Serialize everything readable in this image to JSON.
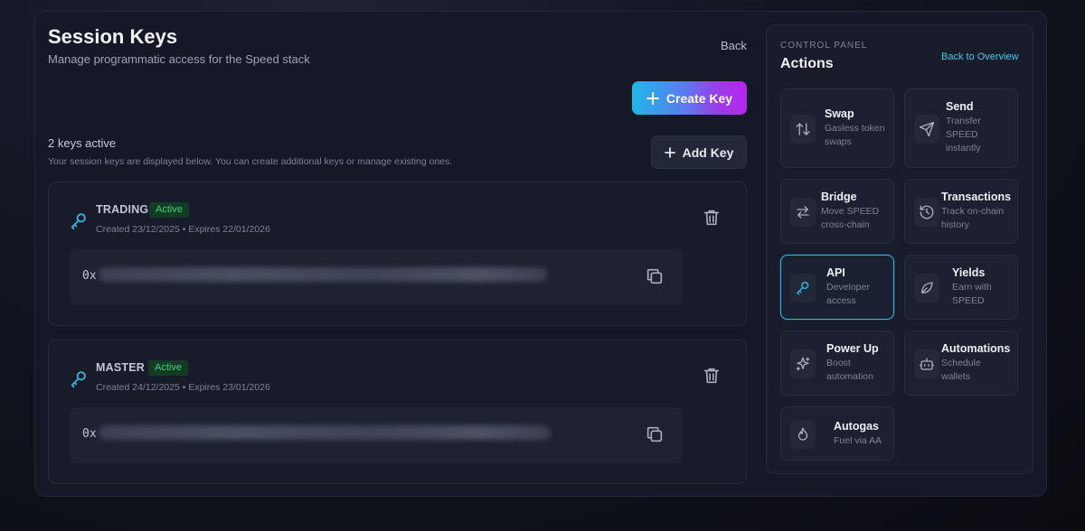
{
  "header": {
    "title": "Session Keys",
    "subtitle": "Manage programmatic access for the Speed stack",
    "back_label": "Back",
    "create_label": "Create Key"
  },
  "keys_summary": {
    "count_text": "2 keys active",
    "hint": "Your session keys are displayed below. You can create additional keys or manage existing ones.",
    "add_label": "Add Key"
  },
  "keys": [
    {
      "name": "TRADING",
      "status": "Active",
      "meta": "Created 23/12/2025 • Expires 22/01/2026",
      "prefix": "0x",
      "value": "••••••••••••••••••••••••••••••••••••••••••••••••••••••••••••••••"
    },
    {
      "name": "MASTER",
      "status": "Active",
      "meta": "Created 24/12/2025 • Expires 23/01/2026",
      "prefix": "0x",
      "value": "••••••••••••••••••••••••••••••••••••••••••••••••••••••••••••••••"
    }
  ],
  "panel": {
    "label": "CONTROL PANEL",
    "title": "Actions",
    "link": "Back to Overview",
    "actions": [
      {
        "label": "Swap",
        "desc": "Gasless token swaps",
        "icon": "swap-arrows-icon"
      },
      {
        "label": "Send",
        "desc": "Transfer SPEED instantly",
        "icon": "send-plane-icon"
      },
      {
        "label": "Bridge",
        "desc": "Move SPEED cross-chain",
        "icon": "bridge-arrows-icon"
      },
      {
        "label": "Transactions",
        "desc": "Track on-chain history",
        "icon": "history-icon"
      },
      {
        "label": "API",
        "desc": "Developer access",
        "icon": "key-icon",
        "active": true
      },
      {
        "label": "Yields",
        "desc": "Earn with SPEED",
        "icon": "leaf-icon"
      },
      {
        "label": "Power Up",
        "desc": "Boost automation",
        "icon": "sparkle-icon"
      },
      {
        "label": "Automations",
        "desc": "Schedule wallets",
        "icon": "robot-icon"
      },
      {
        "label": "Autogas",
        "desc": "Fuel via AA",
        "icon": "flame-icon"
      }
    ]
  },
  "colors": {
    "accent": "#3bb3d6",
    "active_badge": "#37d07a",
    "gradient_start": "#1fb8e6",
    "gradient_end": "#b626ef"
  }
}
